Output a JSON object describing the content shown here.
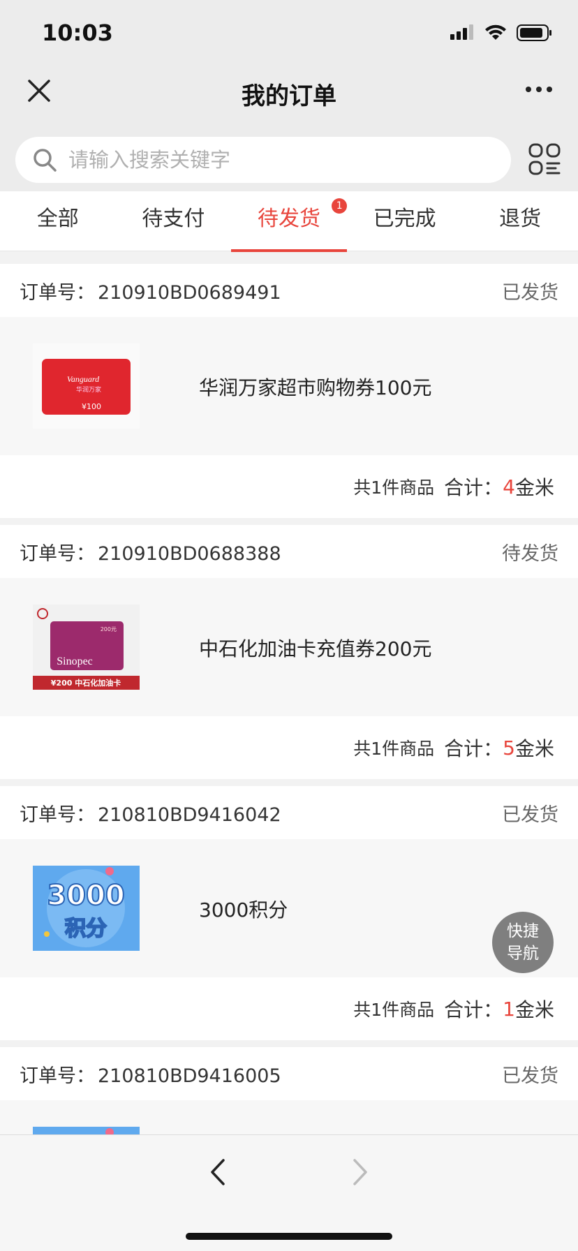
{
  "status_bar": {
    "time": "10:03"
  },
  "nav": {
    "title": "我的订单"
  },
  "search": {
    "placeholder": "请输入搜索关键字"
  },
  "tabs": [
    {
      "label": "全部"
    },
    {
      "label": "待支付"
    },
    {
      "label": "待发货",
      "badge": "1",
      "active": true
    },
    {
      "label": "已完成"
    },
    {
      "label": "退货"
    }
  ],
  "order_labels": {
    "number_prefix": "订单号：",
    "count_text": "共1件商品",
    "total_label": "合计：",
    "unit": "金米"
  },
  "orders": [
    {
      "number": "210910BD0689491",
      "status": "已发货",
      "product": "华润万家超市购物券100元",
      "total": "4",
      "thumb_text": [
        "Vanguard",
        "华润万家",
        "¥100"
      ]
    },
    {
      "number": "210910BD0688388",
      "status": "待发货",
      "product": "中石化加油卡充值券200元",
      "total": "5",
      "thumb_text": [
        "200元",
        "Sinopec",
        "¥200 中石化加油卡"
      ]
    },
    {
      "number": "210810BD9416042",
      "status": "已发货",
      "product": "3000积分",
      "total": "1",
      "thumb_text": [
        "3000",
        "积分"
      ]
    },
    {
      "number": "210810BD9416005",
      "status": "已发货"
    }
  ],
  "fab": {
    "line1": "快捷",
    "line2": "导航"
  },
  "colors": {
    "accent": "#e8453c",
    "background": "#f2f2f2"
  }
}
